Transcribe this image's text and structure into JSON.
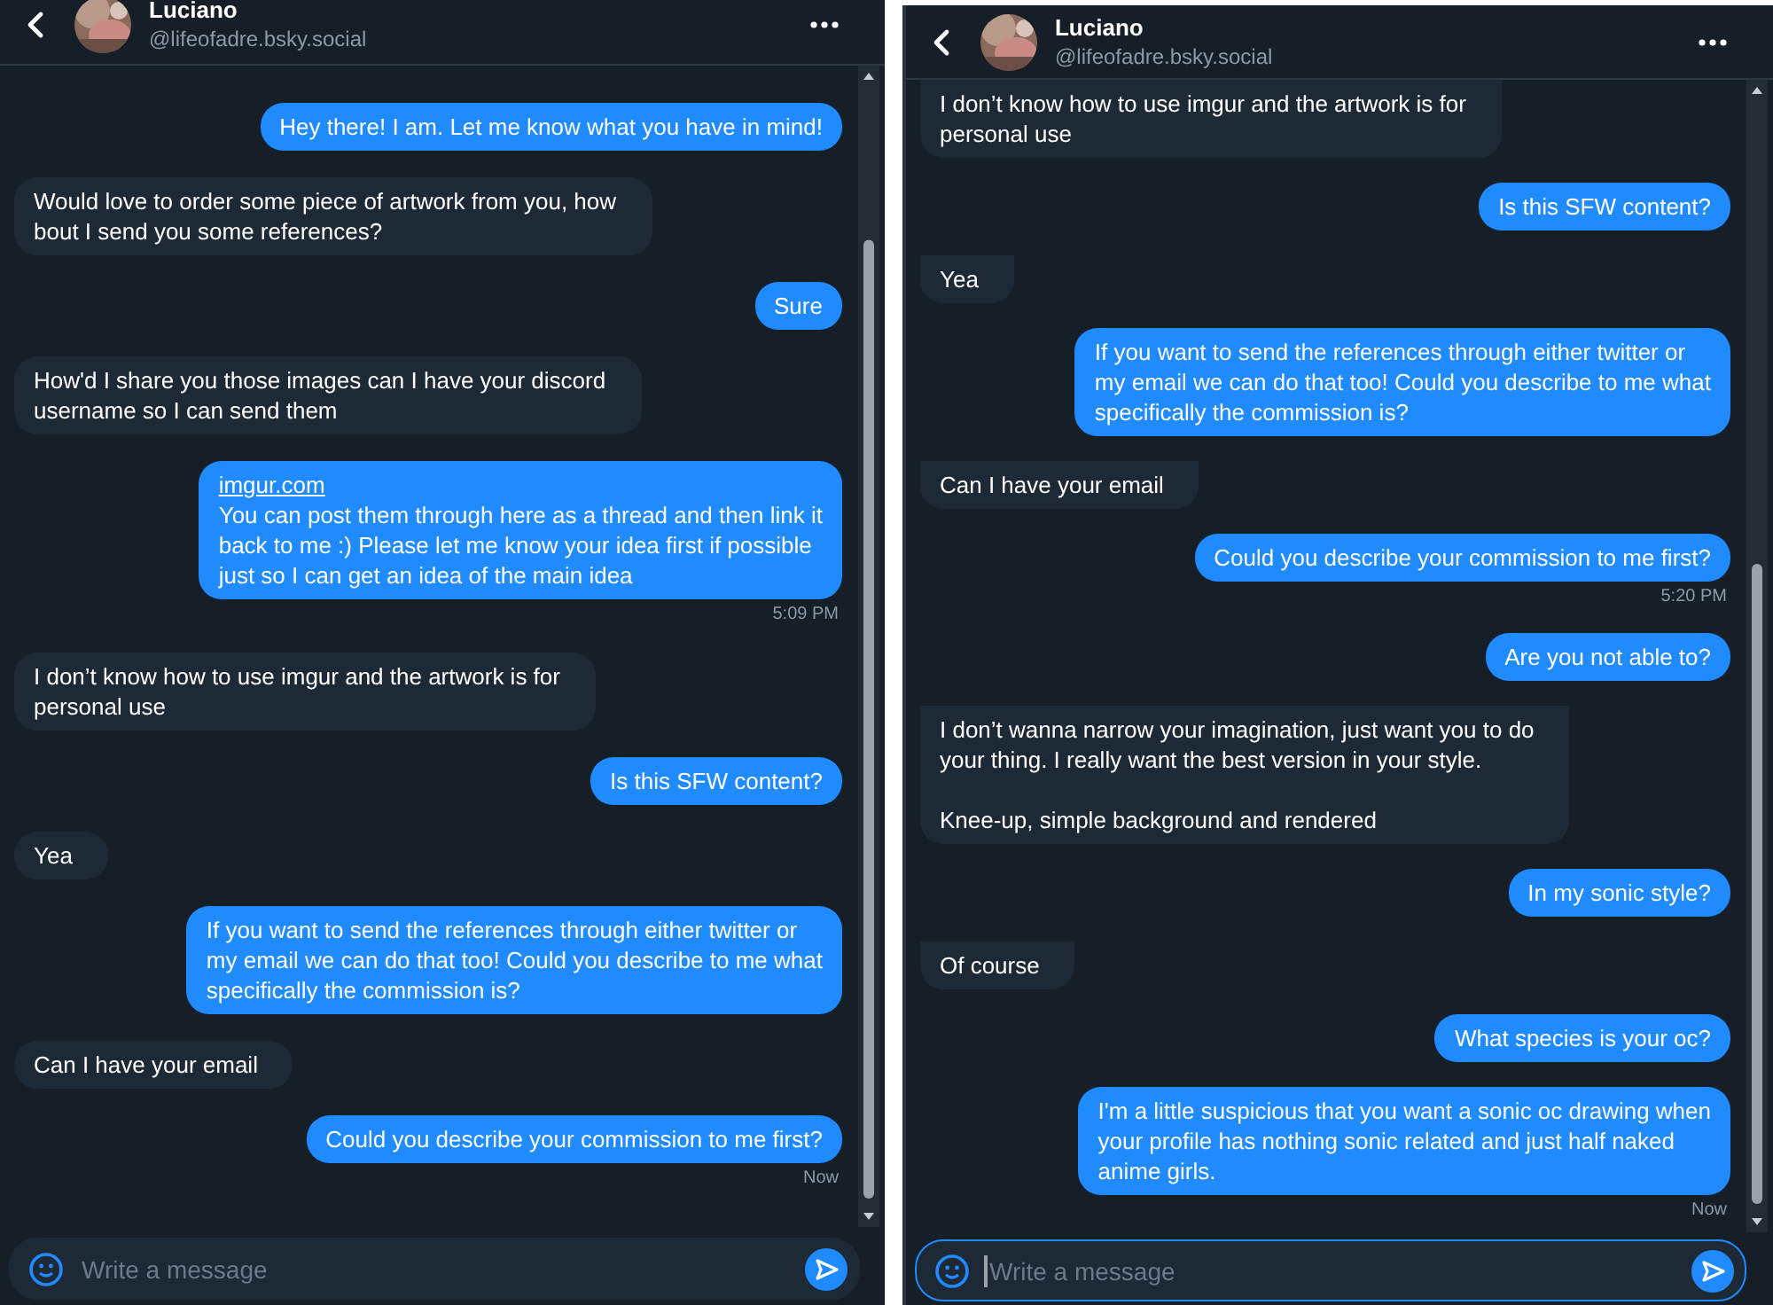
{
  "panels": [
    {
      "header": {
        "name": "Luciano",
        "handle": "@lifeofadre.bsky.social"
      },
      "messages": [
        {
          "kind": "out",
          "text": "Hey there! I am. Let me know what you have in mind!"
        },
        {
          "kind": "in",
          "text": "Would love to order some piece of artwork from you, how\nbout I send you some references?"
        },
        {
          "kind": "out",
          "text": "Sure"
        },
        {
          "kind": "in",
          "text": "How'd I share you those images can I have your discord\nusername so I can send them"
        },
        {
          "kind": "out",
          "link": "imgur.com",
          "text": "You can post them through here as a thread and then link it\nback to me :) Please let me know your idea first if possible\njust so I can get an idea of the main idea",
          "time": "5:09 PM"
        },
        {
          "kind": "in",
          "text": "I don’t know how to use imgur and the artwork is for\npersonal use"
        },
        {
          "kind": "out",
          "text": "Is this SFW content?"
        },
        {
          "kind": "in",
          "text": "Yea"
        },
        {
          "kind": "out",
          "text": "If you want to send the references through either twitter or\nmy email we can do that too! Could you describe to me what\nspecifically the commission is?"
        },
        {
          "kind": "in",
          "text": "Can I have your email"
        },
        {
          "kind": "out",
          "text": "Could you describe your commission to me first?",
          "time": "Now"
        }
      ],
      "composer": {
        "placeholder": "Write a message",
        "focused": false
      }
    },
    {
      "header": {
        "name": "Luciano",
        "handle": "@lifeofadre.bsky.social"
      },
      "messages": [
        {
          "kind": "in",
          "text": "I don’t know how to use imgur and the artwork is for\npersonal use"
        },
        {
          "kind": "out",
          "text": "Is this SFW content?"
        },
        {
          "kind": "in",
          "text": "Yea"
        },
        {
          "kind": "out",
          "text": "If you want to send the references through either twitter or\nmy email we can do that too! Could you describe to me what\nspecifically the commission is?"
        },
        {
          "kind": "in",
          "text": "Can I have your email"
        },
        {
          "kind": "out",
          "text": "Could you describe your commission to me first?",
          "time": "5:20 PM"
        },
        {
          "kind": "out",
          "text": "Are you not able to?"
        },
        {
          "kind": "in",
          "text": "I don’t wanna narrow your imagination, just want you to do\nyour thing. I really want the best version in your style.\n\nKnee-up, simple background and rendered"
        },
        {
          "kind": "out",
          "text": "In my sonic style?"
        },
        {
          "kind": "in",
          "text": "Of course"
        },
        {
          "kind": "out",
          "text": "What species is your oc?"
        },
        {
          "kind": "out",
          "text": "I'm a little suspicious that you want a sonic oc drawing when\nyour profile has nothing sonic related and just half naked\nanime girls.",
          "time": "Now"
        }
      ],
      "composer": {
        "placeholder": "Write a message",
        "focused": true
      }
    }
  ]
}
